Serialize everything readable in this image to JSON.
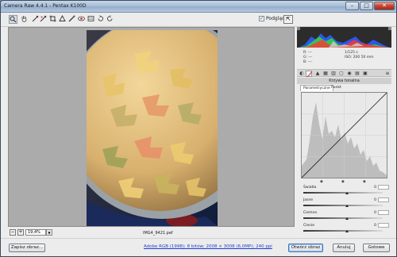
{
  "window": {
    "title": "Camera Raw 4.4.1  -  Pentax K100D",
    "min_label": "–",
    "max_label": "□",
    "close_label": "✕"
  },
  "toolbar": {
    "tools": [
      "zoom-tool",
      "hand-tool",
      "white-balance-tool",
      "color-sampler-tool",
      "crop-tool",
      "straighten-tool",
      "retouch-tool",
      "red-eye-tool",
      "preferences",
      "rotate-left",
      "rotate-right"
    ],
    "preview_label": "Podgląd",
    "preview_checked": true
  },
  "canvas": {
    "zoom_value": "19,4%",
    "filename": "IMG4_9421.pef"
  },
  "info": {
    "r_label": "R:",
    "g_label": "G:",
    "b_label": "B:",
    "r_value": "---",
    "g_value": "---",
    "b_value": "---",
    "exposure": "1/125 s",
    "iso_lens": "ISO: 200    50 mm"
  },
  "panel": {
    "title": "Krzywa tonalna",
    "subtabs": [
      "Parametryczne",
      "Punkt"
    ],
    "sliders": [
      {
        "label": "Światła",
        "value": "0",
        "level": 0.55
      },
      {
        "label": "Jasne",
        "value": "0",
        "level": 0.55
      },
      {
        "label": "Ciemne",
        "value": "0",
        "level": 0.55
      },
      {
        "label": "Cienie",
        "value": "0",
        "level": 0.55
      }
    ]
  },
  "footer": {
    "save_label": "Zapisz obraz...",
    "workflow_label": "Adobe RGB (1998); 8 bitów; 2008 × 3008 (6,0MP); 240 ppi",
    "open_label": "Otwórz obraz",
    "cancel_label": "Anuluj",
    "done_label": "Gotowe"
  },
  "colors": {
    "accent": "#3a78c4",
    "link": "#1f3fcf"
  }
}
